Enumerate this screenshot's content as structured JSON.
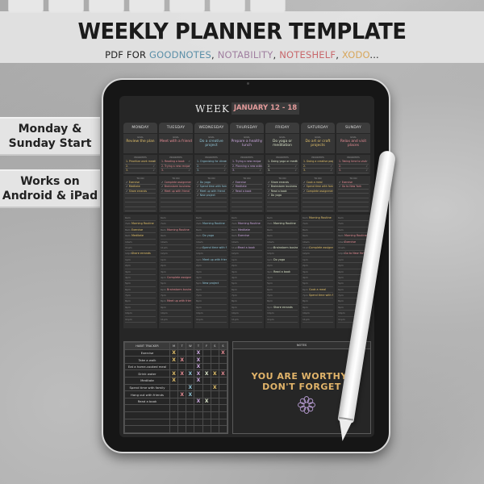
{
  "banner": {
    "title": "WEEKLY PLANNER TEMPLATE",
    "subtitle_prefix": "PDF FOR ",
    "apps": [
      {
        "name": "GOODNOTES",
        "color": "#5b8fa8"
      },
      {
        "name": "NOTABILITY",
        "color": "#a07fa0"
      },
      {
        "name": "NOTESHELF",
        "color": "#c8686c"
      },
      {
        "name": "XODO",
        "color": "#d8a75c"
      }
    ],
    "separator": ", ",
    "suffix": "..."
  },
  "side_labels": [
    {
      "line1": "Monday &",
      "line2": "Sunday Start"
    },
    {
      "line1": "Works on",
      "line2": "Android & iPad"
    }
  ],
  "planner": {
    "week_label": "WEEK",
    "week_range": "JANUARY 12 - 18",
    "goal_label": "GOAL",
    "priorities_label": "PRIORITIES",
    "todo_label": "TO DO",
    "days": [
      {
        "name": "MONDAY",
        "goal": "Review the plan",
        "color": "#e2c06a",
        "priorities": [
          "1. Prioritize work meeting",
          "2.",
          "3."
        ],
        "todos": [
          "Exercise",
          "Meditate",
          "Share errands",
          "",
          "",
          "",
          ""
        ],
        "schedule": [
          [
            "6am",
            ""
          ],
          [
            "7am",
            "Morning Routine"
          ],
          [
            "8am",
            "Exercise"
          ],
          [
            "9am",
            "Meditate"
          ],
          [
            "10am",
            ""
          ],
          [
            "11am",
            ""
          ],
          [
            "12pm",
            "Share errands"
          ],
          [
            "1pm",
            ""
          ],
          [
            "2pm",
            ""
          ],
          [
            "3pm",
            ""
          ],
          [
            "4pm",
            ""
          ],
          [
            "5pm",
            ""
          ],
          [
            "6pm",
            ""
          ],
          [
            "7pm",
            ""
          ],
          [
            "8pm",
            ""
          ],
          [
            "9pm",
            ""
          ],
          [
            "10pm",
            ""
          ],
          [
            "11pm",
            ""
          ]
        ]
      },
      {
        "name": "TUESDAY",
        "goal": "Meet with a friend",
        "color": "#e58c94",
        "priorities": [
          "1. Reading a book",
          "2. Trying a new recipe",
          "3."
        ],
        "todos": [
          "Complete assignments",
          "Brainstorm business ideas",
          "Meet up with friend",
          "",
          "",
          "",
          ""
        ],
        "schedule": [
          [
            "6am",
            ""
          ],
          [
            "7am",
            ""
          ],
          [
            "8am",
            "Morning Routine"
          ],
          [
            "9am",
            ""
          ],
          [
            "10am",
            ""
          ],
          [
            "11am",
            ""
          ],
          [
            "12pm",
            ""
          ],
          [
            "1pm",
            ""
          ],
          [
            "2pm",
            ""
          ],
          [
            "3pm",
            ""
          ],
          [
            "4pm",
            "Complete assignments"
          ],
          [
            "5pm",
            ""
          ],
          [
            "6pm",
            "Brainstorm business ideas"
          ],
          [
            "7pm",
            ""
          ],
          [
            "8pm",
            "Meet up with friend"
          ],
          [
            "9pm",
            ""
          ],
          [
            "10pm",
            ""
          ],
          [
            "11pm",
            ""
          ]
        ]
      },
      {
        "name": "WEDNESDAY",
        "goal": "Do a creative project",
        "color": "#8fc4d6",
        "priorities": [
          "1. Organizing for dinner",
          "2.",
          "3."
        ],
        "todos": [
          "Do yoga",
          "Spend time with family",
          "Meet up with friend",
          "New project",
          "",
          "",
          ""
        ],
        "schedule": [
          [
            "6am",
            ""
          ],
          [
            "7am",
            "Morning Routine"
          ],
          [
            "8am",
            ""
          ],
          [
            "9am",
            "Do yoga"
          ],
          [
            "10am",
            ""
          ],
          [
            "11am",
            "Spend time with family"
          ],
          [
            "12pm",
            ""
          ],
          [
            "1pm",
            "Meet up with friend"
          ],
          [
            "2pm",
            ""
          ],
          [
            "3pm",
            ""
          ],
          [
            "4pm",
            ""
          ],
          [
            "5pm",
            "New project"
          ],
          [
            "6pm",
            ""
          ],
          [
            "7pm",
            ""
          ],
          [
            "8pm",
            ""
          ],
          [
            "9pm",
            ""
          ],
          [
            "10pm",
            ""
          ],
          [
            "11pm",
            ""
          ]
        ]
      },
      {
        "name": "THURSDAY",
        "goal": "Prepare a healthy lunch",
        "color": "#c9a6dc",
        "priorities": [
          "1. Trying a new recipe",
          "2. Planning a new activity",
          "3."
        ],
        "todos": [
          "Exercise",
          "Meditate",
          "Read a book",
          "",
          "",
          "",
          ""
        ],
        "schedule": [
          [
            "6am",
            ""
          ],
          [
            "7am",
            "Morning Routine"
          ],
          [
            "8am",
            "Meditate"
          ],
          [
            "9am",
            "Exercise"
          ],
          [
            "10am",
            ""
          ],
          [
            "11am",
            "Read a book"
          ],
          [
            "12pm",
            ""
          ],
          [
            "1pm",
            ""
          ],
          [
            "2pm",
            ""
          ],
          [
            "3pm",
            ""
          ],
          [
            "4pm",
            ""
          ],
          [
            "5pm",
            ""
          ],
          [
            "6pm",
            ""
          ],
          [
            "7pm",
            ""
          ],
          [
            "8pm",
            ""
          ],
          [
            "9pm",
            ""
          ],
          [
            "10pm",
            ""
          ],
          [
            "11pm",
            ""
          ]
        ]
      },
      {
        "name": "FRIDAY",
        "goal": "Do yoga or meditation",
        "color": "#d9e3c8",
        "priorities": [
          "1. Doing yoga or meditation",
          "2.",
          "3."
        ],
        "todos": [
          "Share errands",
          "Brainstorm business ideas",
          "Read a book",
          "Do yoga",
          "",
          "",
          ""
        ],
        "schedule": [
          [
            "6am",
            ""
          ],
          [
            "7am",
            "Morning Routine"
          ],
          [
            "8am",
            ""
          ],
          [
            "9am",
            ""
          ],
          [
            "10am",
            ""
          ],
          [
            "11am",
            "Brainstorm business ideas"
          ],
          [
            "12pm",
            ""
          ],
          [
            "1pm",
            "Do yoga"
          ],
          [
            "2pm",
            ""
          ],
          [
            "3pm",
            "Read a book"
          ],
          [
            "4pm",
            ""
          ],
          [
            "5pm",
            ""
          ],
          [
            "6pm",
            ""
          ],
          [
            "7pm",
            ""
          ],
          [
            "8pm",
            ""
          ],
          [
            "9pm",
            "Share errands"
          ],
          [
            "10pm",
            ""
          ],
          [
            "11pm",
            ""
          ]
        ]
      },
      {
        "name": "SATURDAY",
        "goal": "Do art or craft projects",
        "color": "#e2c06a",
        "priorities": [
          "1. Doing a creative project",
          "2.",
          "3."
        ],
        "todos": [
          "Cook a meal",
          "Spend time with family",
          "Complete assignments",
          "",
          "",
          "",
          ""
        ],
        "schedule": [
          [
            "6am",
            "Morning Routine"
          ],
          [
            "7am",
            ""
          ],
          [
            "8am",
            ""
          ],
          [
            "9am",
            ""
          ],
          [
            "10am",
            ""
          ],
          [
            "11am",
            "Complete assignments"
          ],
          [
            "12pm",
            ""
          ],
          [
            "1pm",
            ""
          ],
          [
            "2pm",
            ""
          ],
          [
            "3pm",
            ""
          ],
          [
            "4pm",
            ""
          ],
          [
            "5pm",
            ""
          ],
          [
            "6pm",
            "Cook a meal"
          ],
          [
            "7pm",
            "Spend time with family"
          ],
          [
            "8pm",
            ""
          ],
          [
            "9pm",
            ""
          ],
          [
            "10pm",
            ""
          ],
          [
            "11pm",
            ""
          ]
        ]
      },
      {
        "name": "SUNDAY",
        "goal": "Relax and visit places",
        "color": "#e58c94",
        "priorities": [
          "1. Taking time to visit",
          "2.",
          "3."
        ],
        "todos": [
          "Exercise",
          "Go to New York",
          "",
          "",
          "",
          "",
          ""
        ],
        "schedule": [
          [
            "6am",
            ""
          ],
          [
            "7am",
            ""
          ],
          [
            "8am",
            ""
          ],
          [
            "9am",
            "Morning Routine"
          ],
          [
            "10am",
            "Exercise"
          ],
          [
            "11am",
            ""
          ],
          [
            "12pm",
            "Go to New York"
          ],
          [
            "1pm",
            ""
          ],
          [
            "2pm",
            ""
          ],
          [
            "3pm",
            ""
          ],
          [
            "4pm",
            ""
          ],
          [
            "5pm",
            ""
          ],
          [
            "6pm",
            ""
          ],
          [
            "7pm",
            ""
          ],
          [
            "8pm",
            ""
          ],
          [
            "9pm",
            ""
          ],
          [
            "10pm",
            ""
          ],
          [
            "11pm",
            ""
          ]
        ]
      }
    ],
    "habit_tracker": {
      "title": "HABIT TRACKER",
      "columns": [
        "M",
        "T",
        "W",
        "T",
        "F",
        "S",
        "S"
      ],
      "mark": "X",
      "rows": [
        {
          "habit": "Exercise",
          "marks": [
            "M",
            "",
            "",
            "T",
            "",
            "",
            "S"
          ]
        },
        {
          "habit": "Take a walk",
          "marks": [
            "M",
            "T",
            "",
            "T",
            "",
            "",
            ""
          ]
        },
        {
          "habit": "Eat a home-cooked meal",
          "marks": [
            "",
            "",
            "",
            "T",
            "",
            "",
            ""
          ]
        },
        {
          "habit": "Drink water",
          "marks": [
            "M",
            "T",
            "W",
            "T",
            "F",
            "S",
            "S"
          ]
        },
        {
          "habit": "Meditate",
          "marks": [
            "M",
            "",
            "",
            "T",
            "",
            "",
            ""
          ]
        },
        {
          "habit": "Spend time with family",
          "marks": [
            "",
            "",
            "W",
            "",
            "",
            "S",
            ""
          ]
        },
        {
          "habit": "Hang out with friends",
          "marks": [
            "",
            "T",
            "W",
            "",
            "",
            "",
            ""
          ]
        },
        {
          "habit": "Read a book",
          "marks": [
            "",
            "",
            "",
            "T",
            "F",
            "",
            ""
          ]
        },
        {
          "habit": "",
          "marks": [
            "",
            "",
            "",
            "",
            "",
            "",
            ""
          ]
        },
        {
          "habit": "",
          "marks": [
            "",
            "",
            "",
            "",
            "",
            "",
            ""
          ]
        },
        {
          "habit": "",
          "marks": [
            "",
            "",
            "",
            "",
            "",
            "",
            ""
          ]
        },
        {
          "habit": "",
          "marks": [
            "",
            "",
            "",
            "",
            "",
            "",
            ""
          ]
        }
      ],
      "mark_colors": [
        "#e2c06a",
        "#e58c94",
        "#8fc4d6",
        "#c9a6dc",
        "#d9e3c8",
        "#e2c06a",
        "#e58c94"
      ]
    },
    "notes": {
      "title": "NOTES",
      "affirmation_line1": "YOU ARE WORTHY!",
      "affirmation_line2": "DON'T FORGET",
      "doodle": "flower-doodle"
    }
  }
}
